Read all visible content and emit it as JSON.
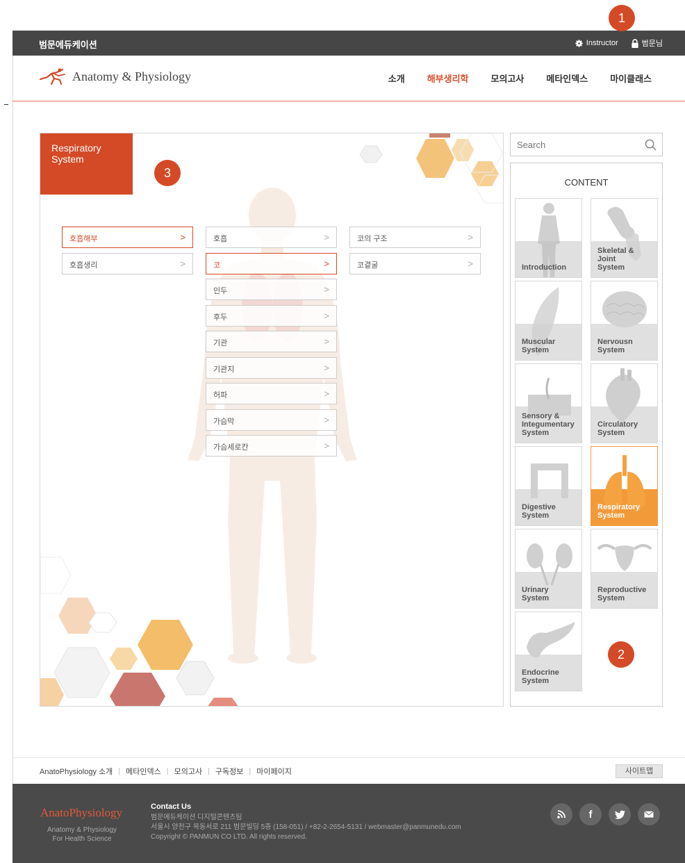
{
  "topbar": {
    "brand": "범문에듀케이션",
    "instructor_label": "Instructor",
    "user_label": "범문님"
  },
  "header": {
    "logo_text": "Anatomy & Physiology",
    "nav": [
      "소개",
      "해부생리학",
      "모의고사",
      "메타인덱스",
      "마이클래스"
    ],
    "active_nav": "해부생리학"
  },
  "badges": {
    "b1": "1",
    "b2": "2",
    "b3": "3"
  },
  "panel": {
    "title_line1": "Respiratory",
    "title_line2": "System",
    "col1": [
      "호흡해부",
      "호흡생리"
    ],
    "col2": [
      "호흡",
      "코",
      "인두",
      "후두",
      "기관",
      "기관지",
      "허파",
      "가슴막",
      "가슴세로칸"
    ],
    "col3": [
      "코의 구조",
      "코곁굴"
    ],
    "active_col1": "호흡해부",
    "active_col2": "코"
  },
  "sidebar": {
    "search_placeholder": "Search",
    "content_title": "CONTENT",
    "tiles": [
      "Introduction",
      "Skeletal &\nJoint\nSystem",
      "Muscular\nSystem",
      "Nervousn\nSystem",
      "Sensory &\nIntegumentary\nSystem",
      "Circulatory\nSystem",
      "Digestive\nSystem",
      "Respiratory\nSystem",
      "Urinary\nSystem",
      "Reproductive\nSystem",
      "Endocrine\nSystem"
    ],
    "active_tile": "Respiratory\nSystem"
  },
  "footer": {
    "links": [
      "AnatoPhysiology 소개",
      "메타인덱스",
      "모의고사",
      "구독정보",
      "마이페이지"
    ],
    "sitemap": "사이트맵",
    "logo": "AnatoPhysiology",
    "tagline1": "Anatomy & Physiology",
    "tagline2": "For Health Science",
    "contact_title": "Contact Us",
    "contact_line1": "범문에듀케이션 디지털콘텐츠팀",
    "contact_line2": "서울시 양천구 목동서로 211 범문빌딩 5층 (158-051) / +82-2-2654-5131 / webmaster@panmunedu.com",
    "copyright": "Copyright © PANMUN CO LTD. All rights reserved."
  },
  "colors": {
    "accent": "#d44a26",
    "active_tile": "#f29a3a",
    "topbar": "#464646",
    "footer": "#4a4a4a"
  }
}
